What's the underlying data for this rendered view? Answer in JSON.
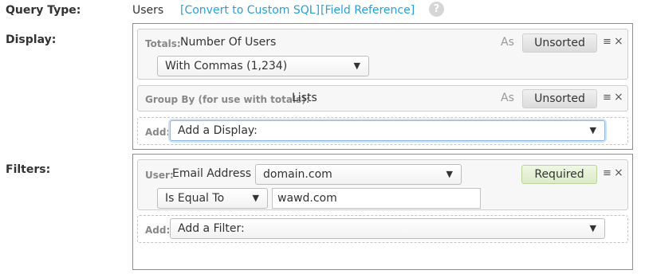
{
  "query_type": {
    "label": "Query Type:",
    "value": "Users",
    "convert_link": "[Convert to Custom SQL]",
    "reference_link": "[Field Reference]",
    "help_glyph": "?"
  },
  "display": {
    "label": "Display:",
    "items": [
      {
        "key": "Totals:",
        "title": "Number Of Users",
        "as_label": "As",
        "sort_button": "Unsorted",
        "format_select": "With Commas (1,234)"
      },
      {
        "key": "Group By (for use with totals):",
        "title": "Lists",
        "as_label": "As",
        "sort_button": "Unsorted"
      }
    ],
    "add": {
      "key": "Add:",
      "select": "Add a Display:"
    }
  },
  "filters": {
    "label": "Filters:",
    "items": [
      {
        "key": "User:",
        "title": "Email Address",
        "field_select": "domain.com",
        "operator_select": "Is Equal To",
        "value_input": "wawd.com",
        "required_button": "Required"
      }
    ],
    "add": {
      "key": "Add:",
      "select": "Add a Filter:"
    }
  },
  "icons": {
    "menu": "≡",
    "close": "×",
    "caret": "▼"
  },
  "colors": {
    "link": "#2a9fd6",
    "required_bg": "#dcebc9",
    "focus_border": "#8eb8e0"
  }
}
